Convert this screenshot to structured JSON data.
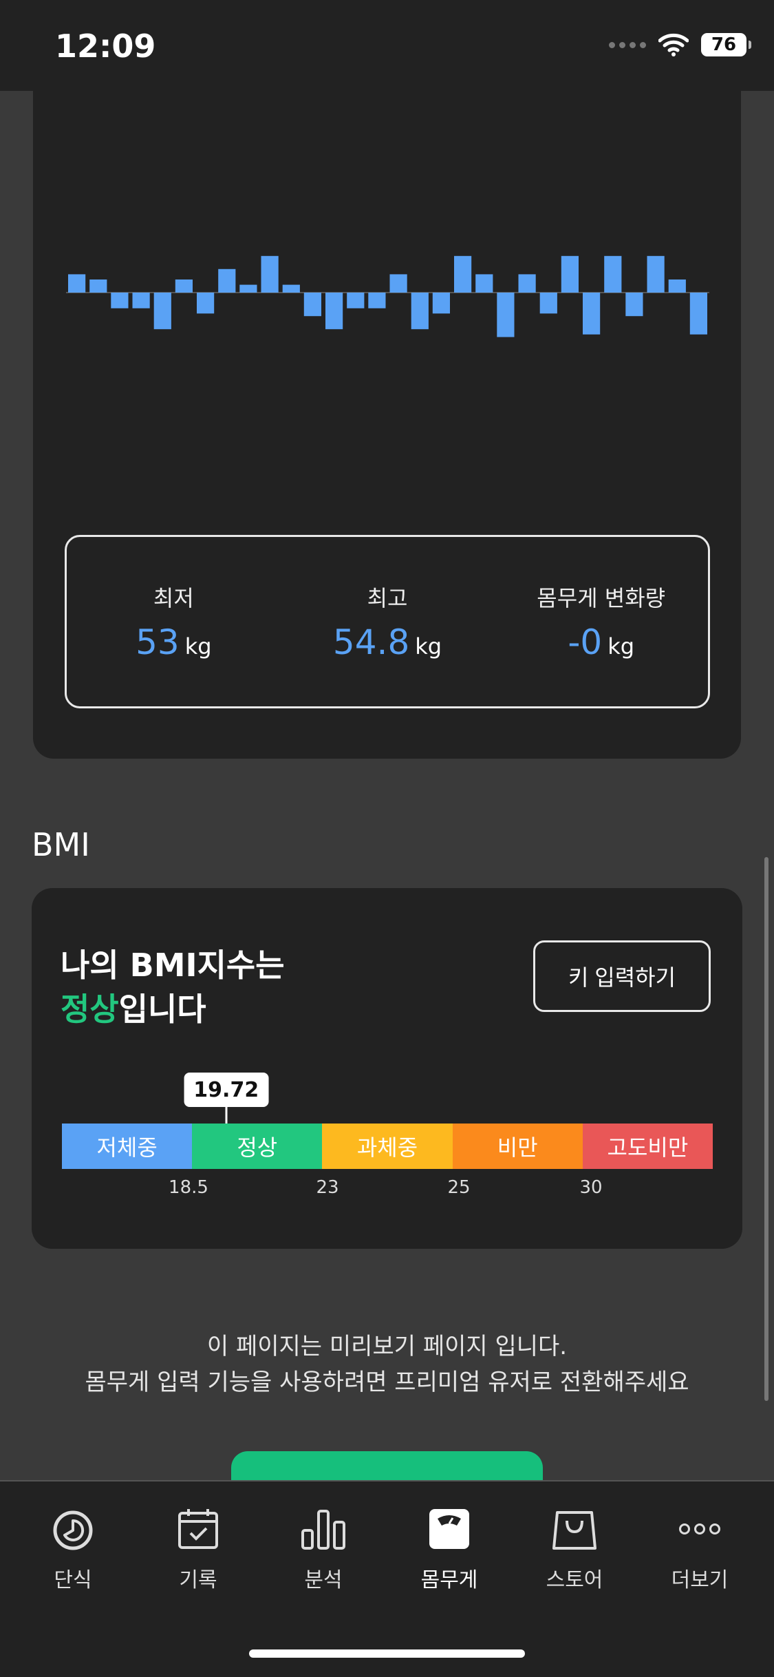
{
  "status_bar": {
    "time": "12:09",
    "battery": "76"
  },
  "weight_chart": {
    "deviations": [
      0.7,
      0.5,
      -0.6,
      -0.6,
      -1.4,
      0.5,
      -0.8,
      0.9,
      0.3,
      1.4,
      0.3,
      -0.9,
      -1.4,
      -0.6,
      -0.6,
      0.7,
      -1.4,
      -0.8,
      1.4,
      0.7,
      -1.7,
      0.7,
      -0.8,
      1.4,
      -1.6,
      1.4,
      -0.9,
      1.4,
      0.5,
      -1.6
    ],
    "color": "#5aa2f5"
  },
  "stats": {
    "min_label": "최저",
    "min_value": "53",
    "min_unit": "kg",
    "max_label": "최고",
    "max_value": "54.8",
    "max_unit": "kg",
    "change_label": "몸무게 변화량",
    "change_value": "-0",
    "change_unit": "kg"
  },
  "bmi": {
    "heading": "BMI",
    "title_line1": "나의 BMI지수는",
    "status": "정상",
    "title_suffix": "입니다",
    "height_button": "키 입력하기",
    "value": "19.72",
    "value_number": 19.72,
    "segments": [
      {
        "label": "저체중",
        "color": "#5aa2f5"
      },
      {
        "label": "정상",
        "color": "#22c77f"
      },
      {
        "label": "과체중",
        "color": "#fdb91f"
      },
      {
        "label": "비만",
        "color": "#fb8a1c"
      },
      {
        "label": "고도비만",
        "color": "#e95757"
      }
    ],
    "ticks": [
      "18.5",
      "23",
      "25",
      "30"
    ]
  },
  "notice": {
    "line1": "이 페이지는 미리보기 페이지 입니다.",
    "line2": "몸무게 입력 기능을 사용하려면 프리미엄 유저로 전환해주세요"
  },
  "tabs": [
    {
      "label": "단식",
      "icon": "fasting-timer-icon"
    },
    {
      "label": "기록",
      "icon": "calendar-check-icon"
    },
    {
      "label": "분석",
      "icon": "bar-chart-icon"
    },
    {
      "label": "몸무게",
      "icon": "scale-icon",
      "active": true
    },
    {
      "label": "스토어",
      "icon": "shopping-bag-icon"
    },
    {
      "label": "더보기",
      "icon": "more-dots-icon"
    }
  ]
}
